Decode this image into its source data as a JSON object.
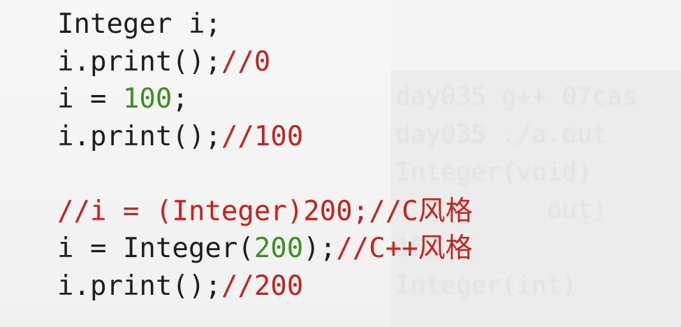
{
  "code_lines": [
    [
      {
        "t": "Integer i;",
        "k": "plain"
      }
    ],
    [
      {
        "t": "i.print();",
        "k": "plain"
      },
      {
        "t": "//0",
        "k": "comment"
      }
    ],
    [
      {
        "t": "i = ",
        "k": "plain"
      },
      {
        "t": "100",
        "k": "number"
      },
      {
        "t": ";",
        "k": "plain"
      }
    ],
    [
      {
        "t": "i.print();",
        "k": "plain"
      },
      {
        "t": "//100",
        "k": "comment"
      }
    ],
    [],
    [
      {
        "t": "//i = (Integer)200;//C风格",
        "k": "comment"
      }
    ],
    [
      {
        "t": "i = Integer(",
        "k": "plain"
      },
      {
        "t": "200",
        "k": "number"
      },
      {
        "t": ");",
        "k": "plain"
      },
      {
        "t": "//C++风格",
        "k": "comment"
      }
    ],
    [
      {
        "t": "i.print();",
        "k": "plain"
      },
      {
        "t": "//200",
        "k": "comment"
      }
    ]
  ],
  "terminal_lines": [
    "day035 g++ 07cas",
    "day035 ./a.out",
    "Integer(void)",
    "          out)",
    "100",
    "Integer(int)"
  ],
  "colors": {
    "plain": "#1e1e1e",
    "comment": "#c8231b",
    "number": "#3f8f1e"
  }
}
